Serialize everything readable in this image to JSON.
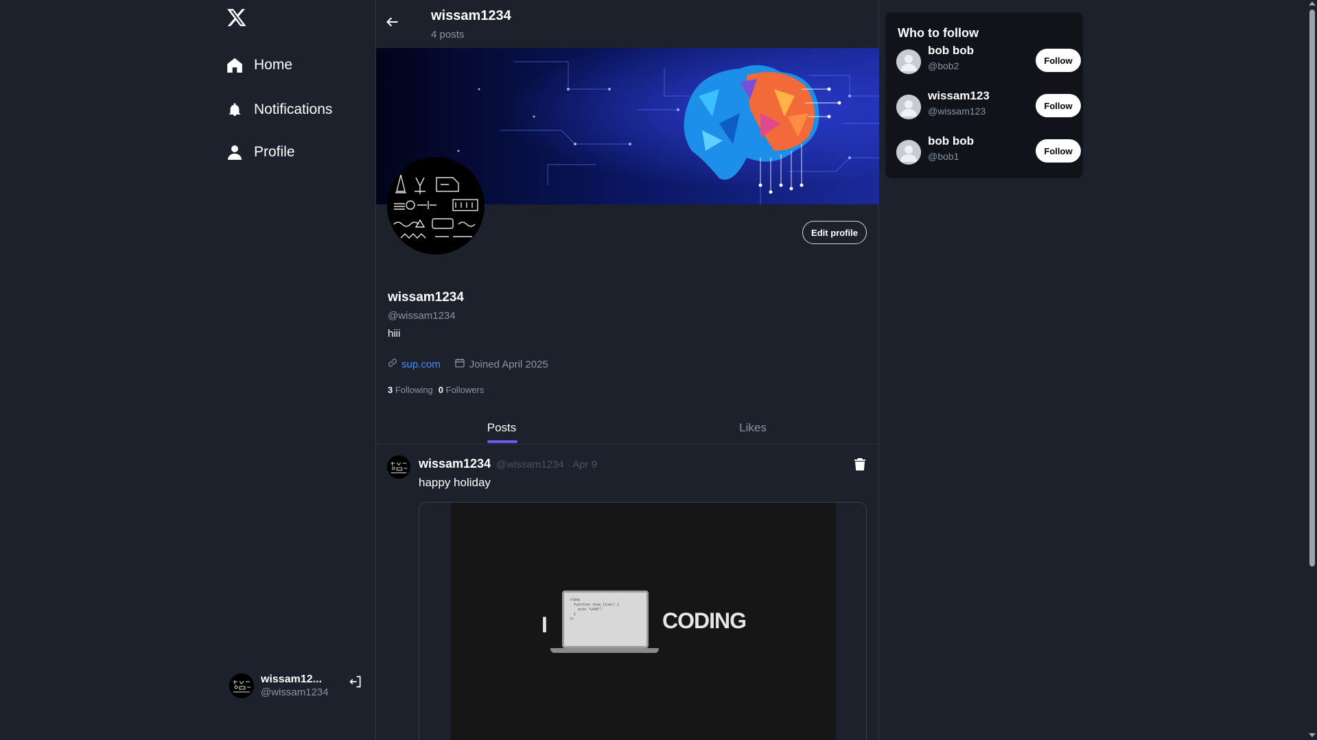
{
  "sidebar": {
    "logo": "x-logo-icon",
    "items": [
      {
        "label": "Home",
        "icon": "home-icon"
      },
      {
        "label": "Notifications",
        "icon": "bell-icon"
      },
      {
        "label": "Profile",
        "icon": "user-icon"
      }
    ],
    "user": {
      "name": "wissam12...",
      "handle": "@wissam1234"
    }
  },
  "header": {
    "title": "wissam1234",
    "subtitle": "4 posts"
  },
  "profile": {
    "edit_label": "Edit profile",
    "name": "wissam1234",
    "handle": "@wissam1234",
    "bio": "hiii",
    "link": "sup.com",
    "joined": "Joined April 2025",
    "following_count": "3",
    "following_label": "Following",
    "followers_count": "0",
    "followers_label": "Followers"
  },
  "tabs": [
    {
      "label": "Posts",
      "active": true
    },
    {
      "label": "Likes",
      "active": false
    }
  ],
  "post": {
    "name": "wissam1234",
    "meta": "@wissam1234 · Apr 9",
    "text": "happy holiday",
    "image": {
      "left_word": "I",
      "right_word": "CODING",
      "code": "<?php\n  function show_line() {\n    echo \"LOVE\";\n  }\n?>"
    }
  },
  "who_to_follow": {
    "title": "Who to follow",
    "button_label": "Follow",
    "users": [
      {
        "name": "bob bob",
        "handle": "@bob2"
      },
      {
        "name": "wissam123",
        "handle": "@wissam123"
      },
      {
        "name": "bob bob",
        "handle": "@bob1"
      }
    ]
  },
  "colors": {
    "background": "#1c212b",
    "panel": "#10131a",
    "accent": "#6a5cf5",
    "link": "#4a90ff",
    "muted": "#8b95a5"
  }
}
